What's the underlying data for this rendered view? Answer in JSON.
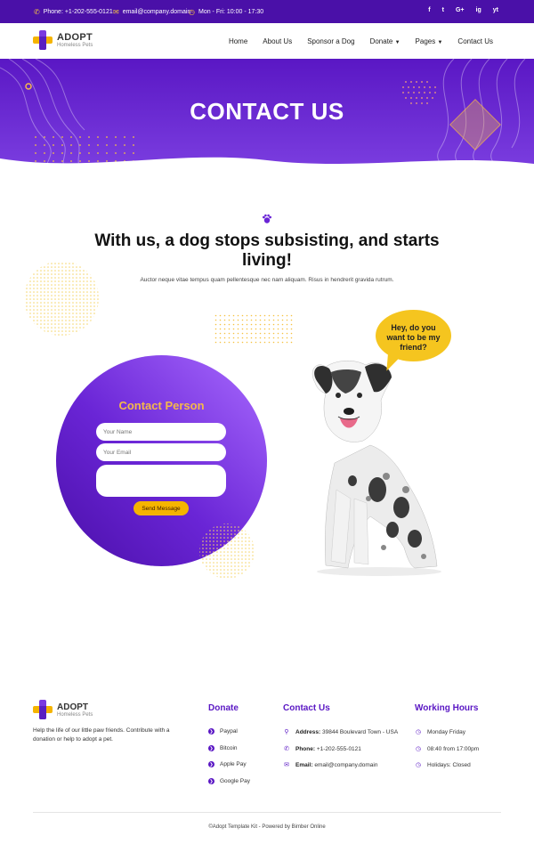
{
  "topbar": {
    "phone": "Phone: +1-202-555-0121",
    "email": "email@company.domain",
    "hours": "Mon - Fri: 10:00 - 17:30",
    "social": [
      "f",
      "t",
      "G+",
      "ig",
      "yt"
    ]
  },
  "brand": {
    "name": "ADOPT",
    "tagline": "Homeless Pets"
  },
  "nav": {
    "home": "Home",
    "about": "About Us",
    "sponsor": "Sponsor a Dog",
    "donate": "Donate",
    "pages": "Pages",
    "contact": "Contact Us"
  },
  "hero": {
    "title": "CONTACT US"
  },
  "intro": {
    "heading": "With us, a dog stops subsisting, and starts living!",
    "subtext": "Auctor neque vitae tempus quam pellentesque nec nam aliquam. Risus in hendrerit gravida rutrum."
  },
  "form": {
    "title": "Contact Person",
    "name_placeholder": "Your Name",
    "email_placeholder": "Your Email",
    "send_label": "Send Message"
  },
  "bubble": {
    "line1": "Hey, do you",
    "line2": "want to be my",
    "line3": "friend?"
  },
  "footer": {
    "description": "Help the life of our little paw friends. Contribute with a donation or help to adopt a pet.",
    "donate": {
      "title": "Donate",
      "items": [
        "Paypal",
        "Bitcoin",
        "Apple Pay",
        "Google Pay"
      ]
    },
    "contact": {
      "title": "Contact Us",
      "address_label": "Address:",
      "address": "39844 Boulevard Town - USA",
      "phone_label": "Phone:",
      "phone": "+1-202-555-0121",
      "email_label": "Email:",
      "email": "email@company.domain"
    },
    "hours": {
      "title": "Working Hours",
      "items": [
        "Monday Friday",
        "08:40 from 17:00pm",
        "Holidays: Closed"
      ]
    },
    "copyright": "©Adopt Template Kit - Powered by Bimber Online"
  },
  "colors": {
    "primary": "#5a17c4",
    "accent": "#f5b400"
  }
}
